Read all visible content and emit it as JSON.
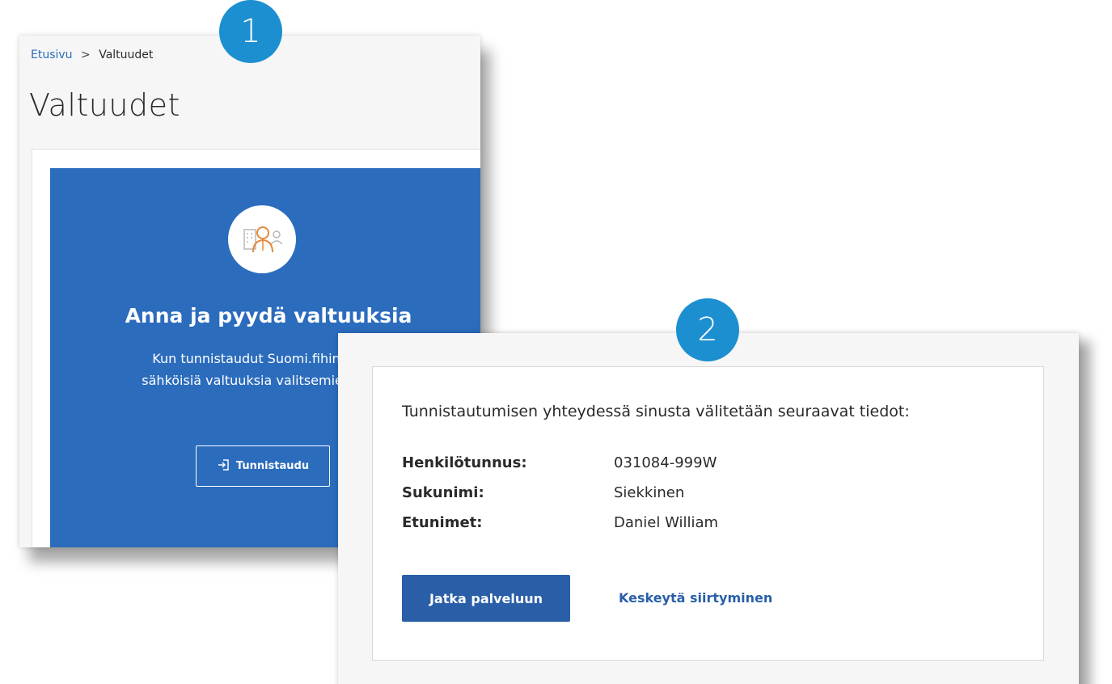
{
  "screen1": {
    "breadcrumb": {
      "home": "Etusivu",
      "separator": ">",
      "current": "Valtuudet"
    },
    "page_title": "Valtuudet",
    "card": {
      "icon": "person-with-building-icon",
      "title": "Anna ja pyydä valtuuksia",
      "text_line1": "Kun tunnistaudut Suomi.fihin, voit a",
      "text_line2": "sähköisiä valtuuksia valitsemiesi asioid",
      "button_icon": "login-icon",
      "button_label": "Tunnistaudu"
    },
    "colors": {
      "card": "#2b6cbd",
      "link": "#2a6ebb"
    }
  },
  "screen2": {
    "heading": "Tunnistautumisen yhteydessä sinusta välitetään seuraavat tiedot:",
    "rows": [
      {
        "label": "Henkilötunnus:",
        "value": "031084-999W"
      },
      {
        "label": "Sukunimi:",
        "value": "Siekkinen"
      },
      {
        "label": "Etunimet:",
        "value": "Daniel William"
      }
    ],
    "continue_label": "Jatka palveluun",
    "cancel_label": "Keskeytä siirtyminen",
    "colors": {
      "button": "#2a5fa8"
    }
  },
  "badges": {
    "step1": "1",
    "step2": "2",
    "color": "#1c8fd1"
  }
}
